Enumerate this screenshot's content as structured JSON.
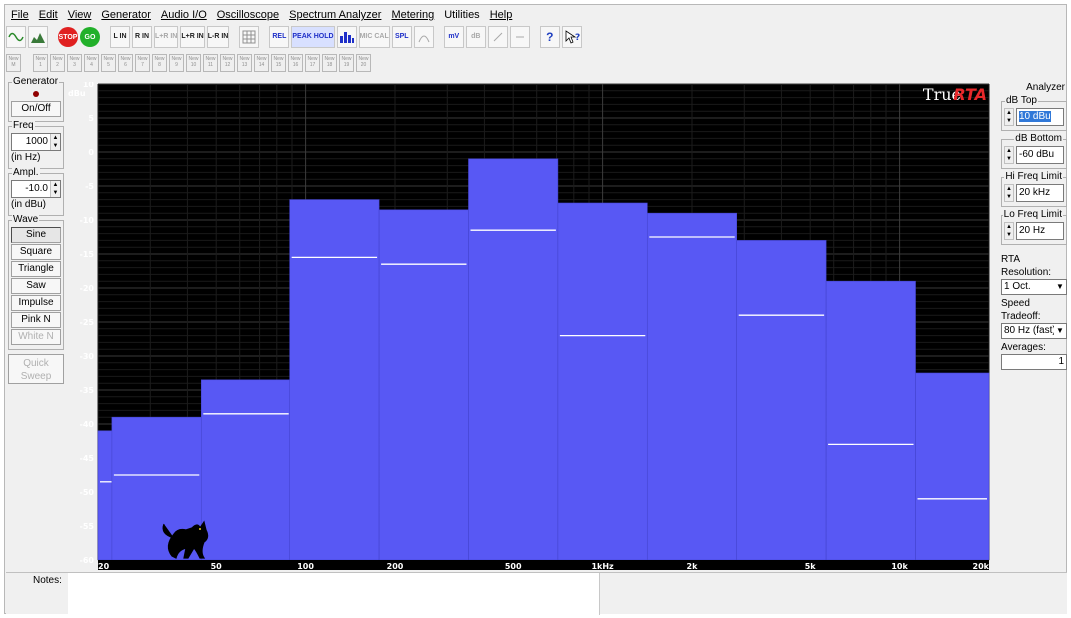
{
  "menu": [
    "File",
    "Edit",
    "View",
    "Generator",
    "Audio I/O",
    "Oscilloscope",
    "Spectrum Analyzer",
    "Metering",
    "Utilities",
    "Help"
  ],
  "toolbar": {
    "stop_label": "STOP",
    "go_label": "GO",
    "channel_buttons": [
      "L IN",
      "R IN",
      "L+R IN",
      "L+R IN",
      "L-R IN"
    ],
    "rel_label": "REL",
    "peak_hold_label": "PEAK HOLD",
    "mic_cal_label": "MIC CAL",
    "spl_label": "SPL",
    "mv_label": "mV",
    "db_label": "dB",
    "help_label": "?"
  },
  "memory": {
    "first_label": "New M",
    "slots": [
      "New 1",
      "New 2",
      "New 3",
      "New 4",
      "New 5",
      "New 6",
      "New 7",
      "New 8",
      "New 9",
      "New 10",
      "New 11",
      "New 12",
      "New 13",
      "New 14",
      "New 15",
      "New 16",
      "New 17",
      "New 18",
      "New 19",
      "New 20"
    ]
  },
  "generator": {
    "title": "Generator",
    "on_off": "On/Off",
    "freq_label": "Freq",
    "freq_value": "1000",
    "freq_unit": "(in Hz)",
    "ampl_label": "Ampl.",
    "ampl_value": "-10.0",
    "ampl_unit": "(in dBu)",
    "wave_label": "Wave",
    "waves": [
      "Sine",
      "Square",
      "Triangle",
      "Saw",
      "Impulse",
      "Pink N",
      "White N"
    ],
    "quick_sweep": "Quick Sweep"
  },
  "analyzer": {
    "title": "Analyzer",
    "db_top_label": "dB Top",
    "db_top_value": "10 dBu",
    "db_bottom_label": "dB Bottom",
    "db_bottom_value": "-60 dBu",
    "hi_freq_label": "Hi Freq Limit",
    "hi_freq_value": "20 kHz",
    "lo_freq_label": "Lo Freq Limit",
    "lo_freq_value": "20 Hz",
    "rta_res_label": "RTA Resolution:",
    "rta_res_value": "1 Oct.",
    "speed_label": "Speed Tradeoff:",
    "speed_value": "80 Hz (fast)",
    "averages_label": "Averages:",
    "averages_value": "1"
  },
  "notes_label": "Notes:",
  "colors": {
    "plot_bg": "#000000",
    "bar": "#5858f4",
    "peak_line": "#ffffff",
    "brand_red": "#e8282a"
  },
  "chart_data": {
    "type": "bar",
    "brand_prefix": "True",
    "brand_suffix": "RTA",
    "ylabel": "dBu",
    "ylim": [
      -60,
      10
    ],
    "yticks": [
      10,
      5,
      0,
      -5,
      -10,
      -15,
      -20,
      -25,
      -30,
      -35,
      -40,
      -45,
      -50,
      -55,
      -60
    ],
    "xscale": "log",
    "xlim": [
      20,
      20000
    ],
    "xticks": [
      {
        "value": 20,
        "label": "20"
      },
      {
        "value": 50,
        "label": "50"
      },
      {
        "value": 100,
        "label": "100"
      },
      {
        "value": 200,
        "label": "200"
      },
      {
        "value": 500,
        "label": "500"
      },
      {
        "value": 1000,
        "label": "1kHz"
      },
      {
        "value": 2000,
        "label": "2k"
      },
      {
        "value": 5000,
        "label": "5k"
      },
      {
        "value": 10000,
        "label": "10k"
      },
      {
        "value": 20000,
        "label": "20k"
      }
    ],
    "grid": true,
    "bands": [
      {
        "center_hz": 16,
        "value": -41,
        "peak": -48.5
      },
      {
        "center_hz": 31.5,
        "value": -39,
        "peak": -47.5
      },
      {
        "center_hz": 63,
        "value": -33.5,
        "peak": -38.5
      },
      {
        "center_hz": 125,
        "value": -7,
        "peak": -15.5
      },
      {
        "center_hz": 250,
        "value": -8.5,
        "peak": -16.5
      },
      {
        "center_hz": 500,
        "value": -1,
        "peak": -11.5
      },
      {
        "center_hz": 1000,
        "value": -7.5,
        "peak": -27
      },
      {
        "center_hz": 2000,
        "value": -9,
        "peak": -12.5
      },
      {
        "center_hz": 4000,
        "value": -13,
        "peak": -24
      },
      {
        "center_hz": 8000,
        "value": -19,
        "peak": -43
      },
      {
        "center_hz": 16000,
        "value": -32.5,
        "peak": -51
      }
    ]
  }
}
